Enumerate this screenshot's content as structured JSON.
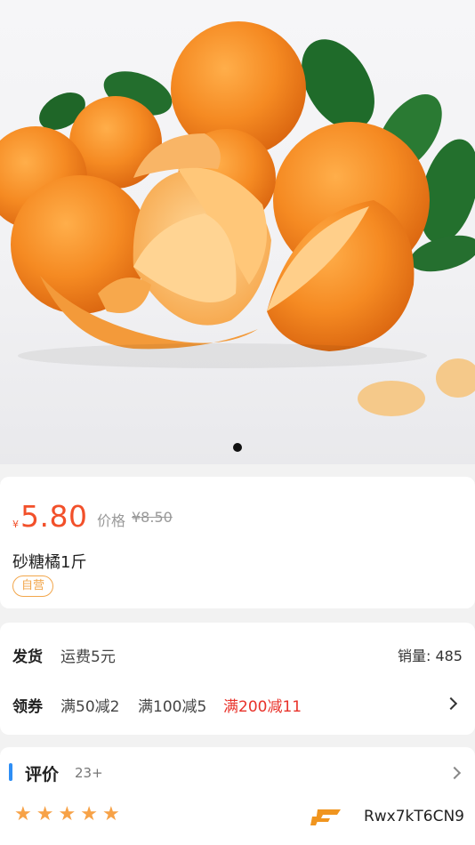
{
  "product": {
    "currency_symbol": "¥",
    "price": "5.80",
    "original_label": "价格",
    "original_price": "¥8.50",
    "title": "砂糖橘1斤",
    "tag": "自营",
    "image_alt": "mandarin oranges photo"
  },
  "carousel": {
    "page_count": 1,
    "active_index": 0
  },
  "shipping": {
    "label": "发货",
    "fee": "运费5元",
    "sales_label": "销量: 485"
  },
  "coupons": {
    "label": "领券",
    "items": [
      "满50减2",
      "满100减5",
      "满200减11"
    ]
  },
  "reviews": {
    "title": "评价",
    "count": "23+",
    "rating": 5,
    "user": "Rwx7kT6CN9"
  },
  "colors": {
    "price": "#f2502a",
    "tag": "#f2a64b",
    "accent_blue": "#2e8ef5",
    "coupon_highlight": "#e8322a",
    "star": "#f7a247"
  }
}
